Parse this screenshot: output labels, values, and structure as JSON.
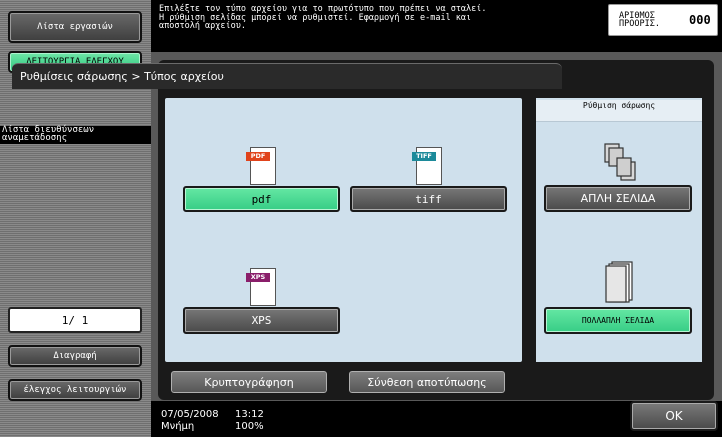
{
  "sidebar": {
    "job_list": "Λίστα εργασιών",
    "check_mode": "ΛΕΙΤΟΥΡΓΙΑ ΕΛΕΓΧΟΥ",
    "address_list": "Λίστα διευθύνσεων αναμετάδοσης",
    "page_indicator": "1/ 1",
    "delete_label": "Διαγραφή",
    "function_check": "έλεγχος λειτουργιών"
  },
  "header": {
    "message": "Επιλέξτε τον τύπο αρχείου για το πρωτότυπο που πρέπει να σταλεί. Η ρύθμιση σελίδας μπορεί να ρυθμιστεί. Εφαρμογή σε e-mail και αποστολή αρχείου.",
    "dest_label": "ΑΡΙΘΜΟΣ ΠΡΟΟΡΙΣ.",
    "dest_count": "000"
  },
  "title": "Ρυθμίσεις σάρωσης > Τύπος αρχείου",
  "file_types": {
    "pdf_tag": "PDF",
    "pdf_label": "pdf",
    "tiff_tag": "TIFF",
    "tiff_label": "tiff",
    "xps_tag": "XPS",
    "xps_label": "XPS",
    "selected": "pdf"
  },
  "scan_setting": {
    "heading": "Ρύθμιση σάρωσης",
    "single_label": "ΑΠΛΗ ΣΕΛΙΔΑ",
    "multi_label": "ΠΟΛΛΑΠΛΗ ΣΕΛΙΔΑ",
    "selected": "multi"
  },
  "bottom_buttons": {
    "encryption": "Κρυπτογράφηση",
    "stamp": "Σύνθεση αποτύπωσης"
  },
  "footer": {
    "date": "07/05/2008",
    "time": "13:12",
    "memory_label": "Μνήμη",
    "memory_value": "100%",
    "ok_label": "OK"
  },
  "colors": {
    "accent_green": "#3fd28a",
    "panel_blue": "#cfe0ec",
    "pdf_red": "#e0431b",
    "tiff_teal": "#1c8a9a",
    "xps_purple": "#8a1e6a"
  }
}
